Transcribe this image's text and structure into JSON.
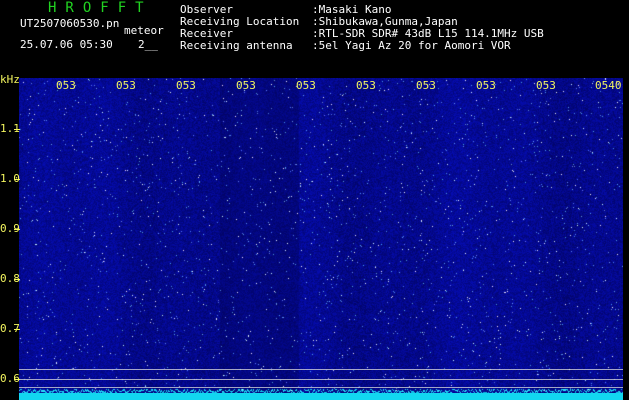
{
  "header": {
    "brand": "HROFFT",
    "filename": "UT2507060530.pn",
    "meteor": "meteor",
    "datetime": "25.07.06 05:30",
    "count": "2__",
    "meta": [
      {
        "key": "Observer",
        "value": ":Masaki Kano"
      },
      {
        "key": "Receiving Location",
        "value": ":Shibukawa,Gunma,Japan"
      },
      {
        "key": "Receiver",
        "value": ":RTL-SDR SDR# 43dB L15 114.1MHz USB"
      },
      {
        "key": "Receiving antenna",
        "value": ":5el Yagi Az 20 for Aomori VOR"
      }
    ]
  },
  "axis": {
    "unit": "kHz",
    "yticks": [
      "1.1",
      "1.0",
      "0.9",
      "0.8",
      "0.7",
      "0.6"
    ]
  },
  "time_labels": [
    "053",
    "053",
    "053",
    "053",
    "053",
    "053",
    "053",
    "053",
    "053",
    "0540"
  ],
  "colors": {
    "background": "#000000",
    "plot_blue": "#0a1a6e",
    "tick_yellow": "#f3f55f",
    "brand_green": "#21d321",
    "baseline_cyan": "#12d7f0",
    "text_white": "#ffffff"
  }
}
